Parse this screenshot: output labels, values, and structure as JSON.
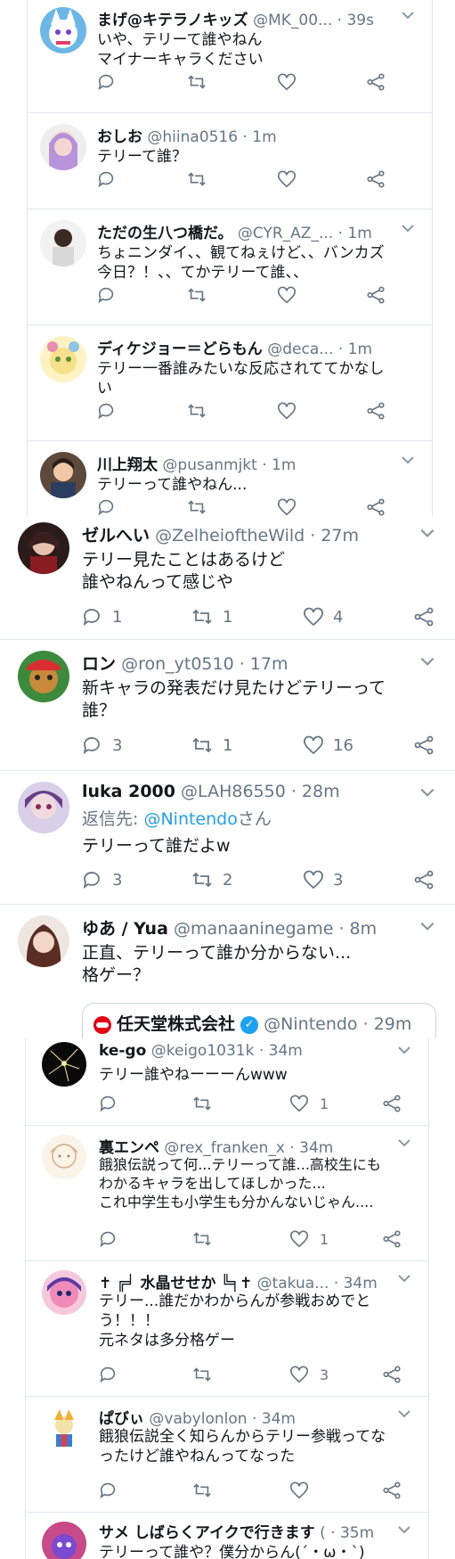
{
  "panel1": {
    "tweets": [
      {
        "name": "まげ@キテラノキッズ",
        "handle": "@MK_00...",
        "time": "· 39s",
        "lines": [
          "いや、テリーて誰やねん",
          "マイナーキャラください"
        ]
      },
      {
        "name": "おしお",
        "handle": "@hiina0516",
        "time": "· 1m",
        "lines": [
          "テリーて誰？"
        ]
      },
      {
        "name": "ただの生八つ橋だ。",
        "handle": "@CYR_AZ_...",
        "time": "· 1m",
        "lines": [
          "ちょニンダイ、、観てねぇけど、、バンカズ",
          "今日？！、、てかテリーて誰、、"
        ]
      },
      {
        "name": "ディケジョー＝どらもん",
        "handle": "@deca...",
        "time": "· 1m",
        "lines": [
          "テリー一番誰みたいな反応されててかなし",
          "い"
        ]
      },
      {
        "name": "川上翔太",
        "handle": "@pusanmjkt",
        "time": "· 1m",
        "lines": [
          "テリーって誰やねん..."
        ]
      }
    ]
  },
  "panel2": {
    "tweets": [
      {
        "name": "ゼルへい",
        "handle": "@ZelheioftheWild",
        "time": "· 27m",
        "lines": [
          "テリー見たことはあるけど",
          "誰やねんって感じや"
        ],
        "reply": "1",
        "retweet": "1",
        "like": "4"
      },
      {
        "name": "ロン",
        "handle": "@ron_yt0510",
        "time": "· 17m",
        "lines": [
          "新キャラの発表だけ見たけどテリーって",
          "誰？"
        ],
        "reply": "3",
        "retweet": "1",
        "like": "16"
      },
      {
        "name": "luka 2000",
        "handle": "@LAH86550",
        "time": "· 28m",
        "reply_prefix": "返信先: ",
        "reply_link": "@Nintendo",
        "reply_suffix": "さん",
        "lines": [
          "テリーって誰だよw"
        ],
        "reply": "3",
        "retweet": "2",
        "like": "3"
      },
      {
        "name": "ゆあ / Yua",
        "handle": "@manaaninegame",
        "time": "· 8m",
        "lines": [
          "正直、テリーって誰か分からない...",
          "格ゲー？"
        ]
      }
    ],
    "quote": {
      "name": "任天堂株式会社",
      "handle": "@Nintendo",
      "time": "· 29m"
    }
  },
  "panel3": {
    "tweets": [
      {
        "name": "ke-go",
        "handle": "@keigo1031k",
        "time": "· 34m",
        "lines": [
          "テリー誰やねーーーんwww"
        ],
        "like": "1"
      },
      {
        "name": "裏エンペ",
        "handle": "@rex_franken_x",
        "time": "· 34m",
        "lines": [
          "餓狼伝説って何...テリーって誰...高校生にも",
          "わかるキャラを出してほしかった...",
          "これ中学生も小学生も分かんないじゃん...."
        ],
        "like": "1"
      },
      {
        "name": "✝ ╔╛ 水晶せせか ╚╕✝",
        "handle": "@takua...",
        "time": "· 34m",
        "lines": [
          "テリー...誰だかわからんが参戦おめでと",
          "う！！！",
          "元ネタは多分格ゲー"
        ],
        "like": "3"
      },
      {
        "name": "ぱびぃ",
        "handle": "@vabylonlon",
        "time": "· 34m",
        "lines": [
          "餓狼伝説全く知らんからテリー参戦ってな",
          "ったけど誰やねんってなった"
        ]
      },
      {
        "name": "サメ しばらくアイクで行きます",
        "handle": "(",
        "time": "· 35m",
        "lines": [
          "テリーって誰や？僕分からん(´・ω・`)"
        ]
      }
    ]
  },
  "colors": {
    "accent": "#1da1f2",
    "text": "#14171a",
    "muted": "#657786",
    "border": "#e1e8ed"
  },
  "icons": [
    "reply-icon",
    "retweet-icon",
    "like-icon",
    "share-icon",
    "chevron-down-icon",
    "verified-icon",
    "nintendo-logo-icon"
  ]
}
